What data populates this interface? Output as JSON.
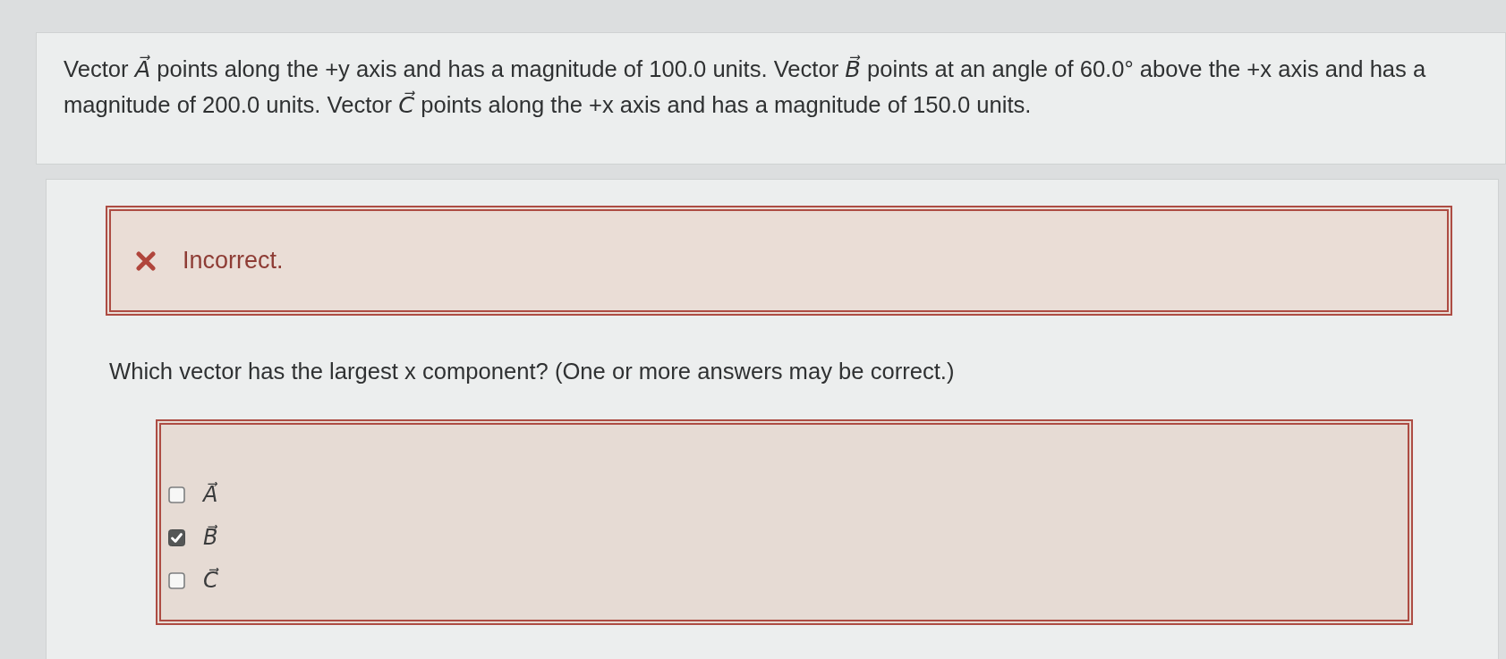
{
  "problem": {
    "text": "Vector *A⃗* points along the +y axis and has a magnitude of 100.0 units. Vector *B⃗* points at an angle of 60.0° above the +x axis and has a magnitude of 200.0 units. Vector *C⃗* points along the +x axis and has a magnitude of 150.0 units."
  },
  "feedback": {
    "kind": "incorrect",
    "message": "Incorrect."
  },
  "question": {
    "text": "Which vector has the largest x component? (One or more answers may be correct.)"
  },
  "options": [
    {
      "label": "A⃗",
      "checked": false
    },
    {
      "label": "B⃗",
      "checked": true
    },
    {
      "label": "C⃗",
      "checked": false
    }
  ]
}
